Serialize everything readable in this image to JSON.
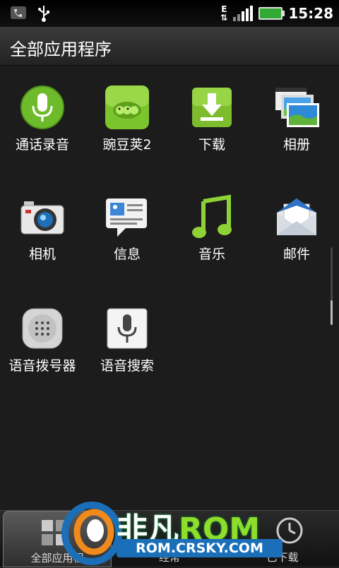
{
  "status": {
    "network_type": "E",
    "time": "15:28"
  },
  "title": "全部应用程序",
  "apps": [
    {
      "label": "通话录音",
      "icon": "call-recorder-icon"
    },
    {
      "label": "豌豆荚2",
      "icon": "wandoujia-icon"
    },
    {
      "label": "下载",
      "icon": "download-icon"
    },
    {
      "label": "相册",
      "icon": "gallery-icon"
    },
    {
      "label": "相机",
      "icon": "camera-icon"
    },
    {
      "label": "信息",
      "icon": "messages-icon"
    },
    {
      "label": "音乐",
      "icon": "music-icon"
    },
    {
      "label": "邮件",
      "icon": "mail-icon"
    },
    {
      "label": "语音拨号器",
      "icon": "voice-dialer-icon"
    },
    {
      "label": "语音搜索",
      "icon": "voice-search-icon"
    }
  ],
  "tabs": [
    {
      "label": "全部应用程",
      "active": true
    },
    {
      "label": "经常",
      "active": false
    },
    {
      "label": "已下载",
      "active": false
    }
  ],
  "watermark": {
    "brand": "非凡",
    "brand_rom": "ROM",
    "url": "ROM.CRSKY.COM"
  }
}
